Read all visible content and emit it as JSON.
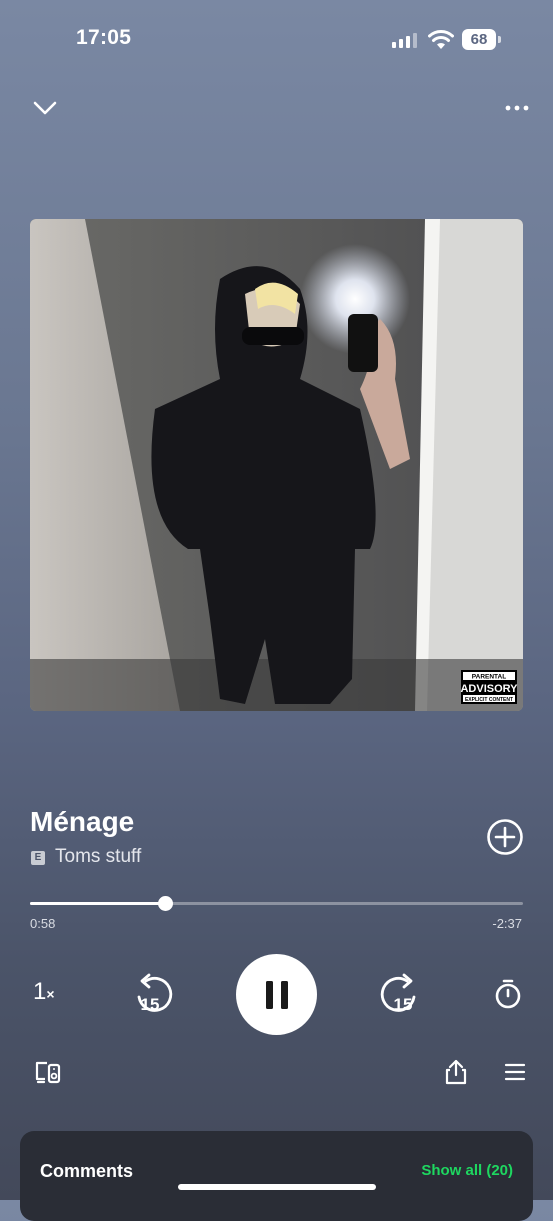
{
  "status_bar": {
    "time": "17:05",
    "battery": "68"
  },
  "track": {
    "title": "Ménage",
    "explicit_badge": "E",
    "artist": "Toms stuff",
    "progress": 0.274
  },
  "artwork": {
    "advisory_line1": "PARENTAL",
    "advisory_line2": "ADVISORY",
    "advisory_line3": "EXPLICIT CONTENT"
  },
  "playback": {
    "elapsed": "0:58",
    "remaining": "-2:37",
    "speed": "1",
    "speed_suffix": "×",
    "skip_back": "15",
    "skip_forward": "15"
  },
  "comments": {
    "title": "Comments",
    "show_all": "Show all (20)"
  },
  "icons": [
    "chevron-down-icon",
    "more-icon",
    "add-icon",
    "skip-back-15-icon",
    "pause-icon",
    "skip-forward-15-icon",
    "timer-icon",
    "devices-icon",
    "share-icon",
    "queue-icon"
  ]
}
